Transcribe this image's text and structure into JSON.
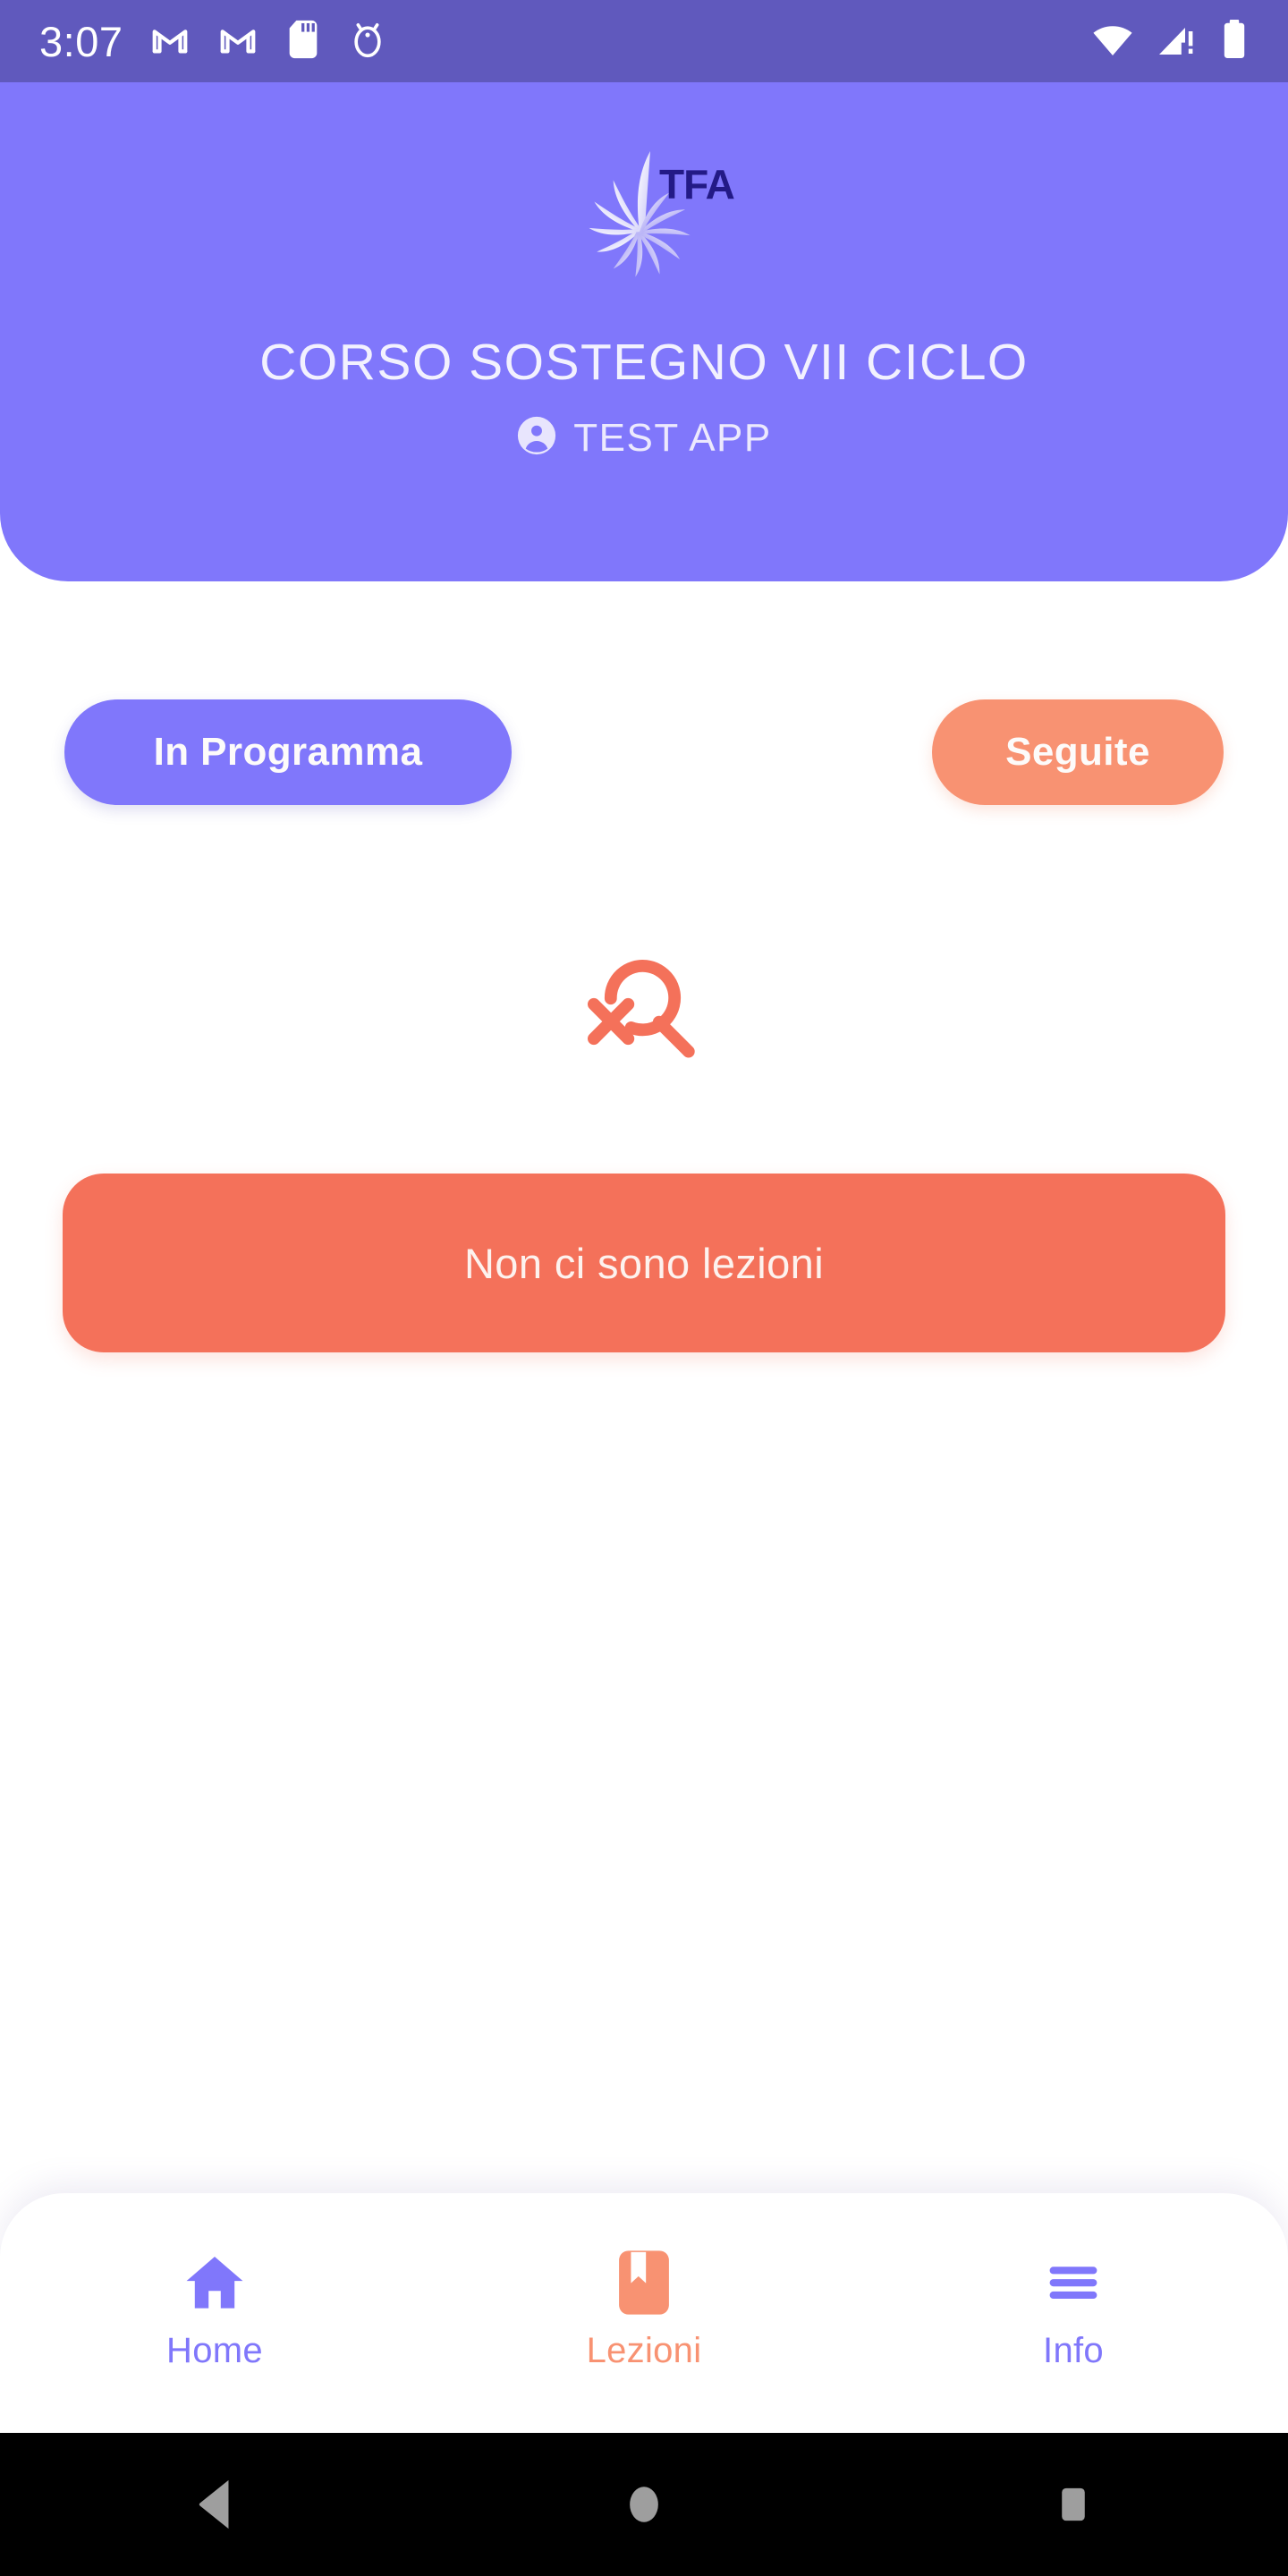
{
  "status_bar": {
    "time": "3:07",
    "left_icons": [
      "gmail-icon",
      "gmail-icon",
      "sd-card-icon",
      "android-head-icon"
    ],
    "right_icons": [
      "wifi-icon",
      "cellular-signal-warning-icon",
      "battery-icon"
    ],
    "background_color": "#6059bd",
    "foreground_color": "#ffffff"
  },
  "header": {
    "logo_name": "tfa-sunburst-logo",
    "logo_text": "TFA",
    "title": "CORSO SOSTEGNO VII CICLO",
    "user_icon": "account-circle-icon",
    "user_name": "TEST APP",
    "background_color": "#8077fb",
    "text_color": "#f2f1fe"
  },
  "filters": {
    "in_programma": {
      "label": "In Programma",
      "color": "#8077fb",
      "text_color": "#fdfbfa",
      "selected": true
    },
    "seguite": {
      "label": "Seguite",
      "color": "#f89272",
      "text_color": "#fdfbfa",
      "selected": false
    }
  },
  "empty_state": {
    "icon_name": "search-not-found-icon",
    "icon_color": "#f4715a",
    "banner_text": "Non ci sono lezioni",
    "banner_color": "#f4715a",
    "banner_text_color": "#fdf2ee"
  },
  "bottom_nav": {
    "items": [
      {
        "label": "Home",
        "icon": "home-icon",
        "color": "#8077fb",
        "active": false
      },
      {
        "label": "Lezioni",
        "icon": "book-icon",
        "color": "#f89272",
        "active": true
      },
      {
        "label": "Info",
        "icon": "hamburger-menu-icon",
        "color": "#8077fb",
        "active": false
      }
    ]
  },
  "system_nav": {
    "back": "back-triangle-icon",
    "home": "home-circle-icon",
    "recents": "recents-square-icon",
    "background_color": "#000000",
    "icon_color": "#9e9e9e"
  }
}
